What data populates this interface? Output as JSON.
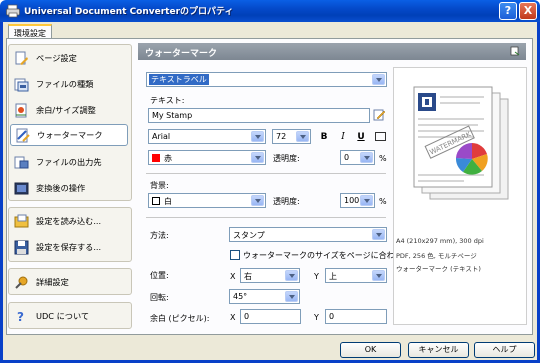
{
  "window": {
    "title": "Universal Document Converterのプロパティ",
    "help_label": "?",
    "close_label": "X"
  },
  "tab": {
    "label": "環境設定"
  },
  "nav": {
    "group1": [
      {
        "label": "ページ設定",
        "icon": "page-setup-icon"
      },
      {
        "label": "ファイルの種類",
        "icon": "file-format-icon"
      },
      {
        "label": "余白/サイズ調整",
        "icon": "margins-icon"
      },
      {
        "label": "ウォーターマーク",
        "icon": "watermark-icon",
        "selected": true
      },
      {
        "label": "ファイルの出力先",
        "icon": "output-folder-icon"
      },
      {
        "label": "変換後の操作",
        "icon": "post-action-icon"
      }
    ],
    "group2": [
      {
        "label": "設定を読み込む...",
        "icon": "load-settings-icon"
      },
      {
        "label": "設定を保存する...",
        "icon": "save-settings-icon"
      }
    ],
    "group3": [
      {
        "label": "詳細設定",
        "icon": "advanced-icon"
      }
    ],
    "group4": [
      {
        "label": "UDC について",
        "icon": "about-icon"
      }
    ]
  },
  "content": {
    "header": "ウォーターマーク",
    "type_select": "テキストラベル",
    "text_label": "テキスト:",
    "text_value": "My Stamp",
    "font_name": "Arial",
    "font_size": "72",
    "bold": "B",
    "italic": "I",
    "underline": "U",
    "text_color": "赤",
    "transparency_label1": "透明度:",
    "transparency_value1": "0",
    "percent": "%",
    "background_label": "背景:",
    "background_color": "白",
    "transparency_label2": "透明度:",
    "transparency_value2": "100",
    "method_label": "方法:",
    "method_value": "スタンプ",
    "fit_label": "ウォーターマークのサイズをページに合わ",
    "position_label": "位置:",
    "x_label": "X",
    "x_value": "右",
    "y_label": "Y",
    "y_value": "上",
    "rotation_label": "回転:",
    "rotation_value": "45°",
    "margin_label": "余白 (ピクセル):",
    "margin_x_label": "X",
    "margin_x_value": "0",
    "margin_y_label": "Y",
    "margin_y_value": "0"
  },
  "preview": {
    "watermark_text": "WATERMARK",
    "line1": "A4 (210x297 mm), 300 dpi",
    "line2": "PDF, 256 色, モルチページ",
    "line3": "ウォーターマーク (テキスト)"
  },
  "buttons": {
    "ok": "OK",
    "cancel": "キャンセル",
    "help": "ヘルプ"
  },
  "colors": {
    "accent": "#316ac5",
    "text_color_swatch": "#ff0000",
    "background_swatch": "#ffffff",
    "title_bar": "#0449c9"
  }
}
